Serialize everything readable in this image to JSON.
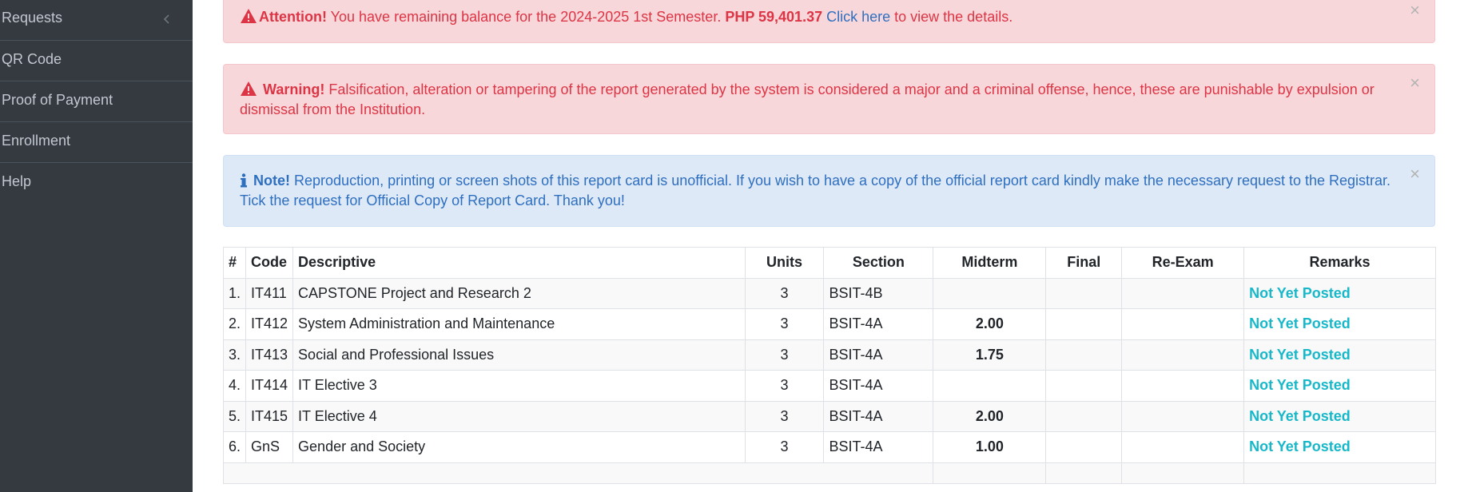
{
  "sidebar": {
    "items": [
      {
        "label": "Requests"
      },
      {
        "label": "QR Code"
      },
      {
        "label": "Proof of Payment"
      },
      {
        "label": "Enrollment"
      },
      {
        "label": "Help"
      }
    ]
  },
  "alerts": {
    "attention": {
      "title": "Attention!",
      "text_before": " You have remaining balance for the 2024-2025 1st Semester. ",
      "amount": "PHP 59,401.37",
      "link": " Click here",
      "text_after": " to view the details.",
      "close": "×"
    },
    "warning": {
      "title": "Warning!",
      "text": " Falsification, alteration or tampering of the report generated by the system is considered a major and a criminal offense, hence, these are punishable by expulsion or dismissal from the Institution.",
      "close": "×"
    },
    "note": {
      "title": "Note!",
      "text": " Reproduction, printing or screen shots of this report card is unofficial. If you wish to have a copy of the official report card kindly make the necessary request to the Registrar. Tick the request for Official Copy of Report Card. Thank you!",
      "close": "×"
    }
  },
  "colors": {
    "danger": "#dc3545",
    "info": "#2f6fc0",
    "remark": "#17b8c9",
    "sidebar": "#343a40"
  },
  "grades_table": {
    "headers": [
      "#",
      "Code",
      "Descriptive",
      "Units",
      "Section",
      "Midterm",
      "Final",
      "Re-Exam",
      "Remarks"
    ],
    "rows": [
      {
        "num": "1.",
        "code": "IT411",
        "desc": "CAPSTONE Project and Research 2",
        "units": "3",
        "section": "BSIT-4B",
        "midterm": "",
        "final": "",
        "reexam": "",
        "remarks": "Not Yet Posted"
      },
      {
        "num": "2.",
        "code": "IT412",
        "desc": "System Administration and Maintenance",
        "units": "3",
        "section": "BSIT-4A",
        "midterm": "2.00",
        "final": "",
        "reexam": "",
        "remarks": "Not Yet Posted"
      },
      {
        "num": "3.",
        "code": "IT413",
        "desc": "Social and Professional Issues",
        "units": "3",
        "section": "BSIT-4A",
        "midterm": "1.75",
        "final": "",
        "reexam": "",
        "remarks": "Not Yet Posted"
      },
      {
        "num": "4.",
        "code": "IT414",
        "desc": "IT Elective 3",
        "units": "3",
        "section": "BSIT-4A",
        "midterm": "",
        "final": "",
        "reexam": "",
        "remarks": "Not Yet Posted"
      },
      {
        "num": "5.",
        "code": "IT415",
        "desc": "IT Elective 4",
        "units": "3",
        "section": "BSIT-4A",
        "midterm": "2.00",
        "final": "",
        "reexam": "",
        "remarks": "Not Yet Posted"
      },
      {
        "num": "6.",
        "code": "GnS",
        "desc": "Gender and Society",
        "units": "3",
        "section": "BSIT-4A",
        "midterm": "1.00",
        "final": "",
        "reexam": "",
        "remarks": "Not Yet Posted"
      }
    ]
  }
}
